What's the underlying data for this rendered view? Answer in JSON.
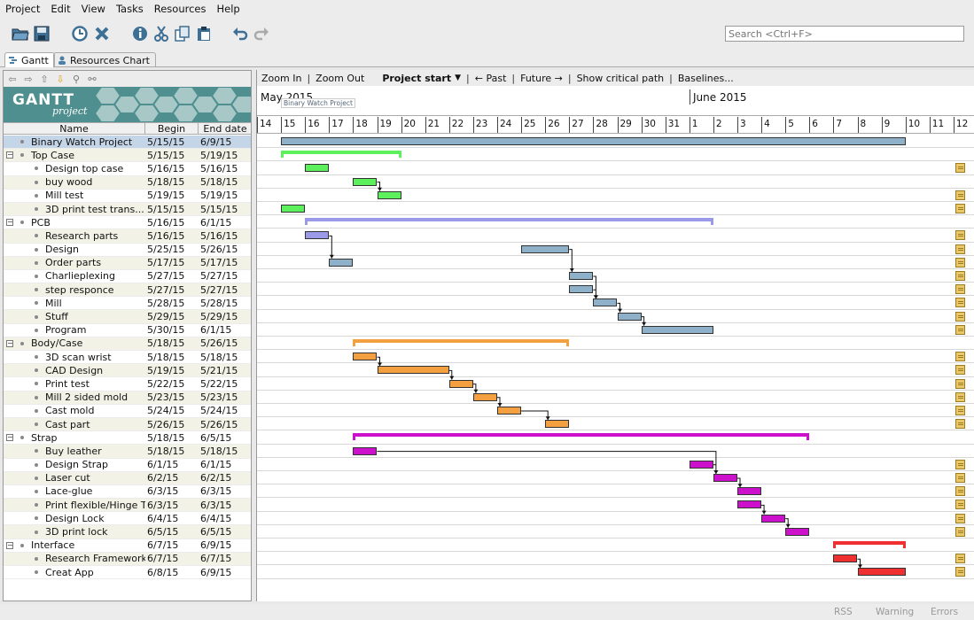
{
  "menu": [
    "Project",
    "Edit",
    "View",
    "Tasks",
    "Resources",
    "Help"
  ],
  "search_placeholder": "Search <Ctrl+F>",
  "tabs": [
    "Gantt",
    "Resources Chart"
  ],
  "logo": {
    "title": "GANTT",
    "subtitle": "project"
  },
  "table_headers": {
    "name": "Name",
    "begin": "Begin date",
    "end": "End date"
  },
  "gantt_toolbar": {
    "zoom_in": "Zoom In",
    "zoom_out": "Zoom Out",
    "project_start": "Project start",
    "past": "← Past",
    "future": "Future →",
    "critical": "Show critical path",
    "baselines": "Baselines..."
  },
  "timeline": {
    "month1": "May 2015",
    "month2": "June 2015",
    "tooltip": "Binary Watch Project",
    "days": [
      "14",
      "15",
      "16",
      "17",
      "18",
      "19",
      "20",
      "21",
      "22",
      "23",
      "24",
      "25",
      "26",
      "27",
      "28",
      "29",
      "30",
      "31",
      "1",
      "2",
      "3",
      "4",
      "5",
      "6",
      "7",
      "8",
      "9",
      "10",
      "11",
      "12"
    ]
  },
  "tasks": [
    {
      "name": "Binary Watch Project",
      "begin": "5/15/15",
      "end": "6/9/15",
      "level": 0,
      "group": false,
      "start": 15,
      "dur": 26,
      "color": "#8eb0c8",
      "note": false
    },
    {
      "name": "Top Case",
      "begin": "5/15/15",
      "end": "5/19/15",
      "level": 0,
      "group": true,
      "start": 15,
      "dur": 5,
      "color": "#5cf05c",
      "note": false
    },
    {
      "name": "Design top case",
      "begin": "5/16/15",
      "end": "5/16/15",
      "level": 1,
      "group": false,
      "start": 16,
      "dur": 1,
      "color": "#5cf05c",
      "note": true
    },
    {
      "name": "buy wood",
      "begin": "5/18/15",
      "end": "5/18/15",
      "level": 1,
      "group": false,
      "start": 18,
      "dur": 1,
      "color": "#5cf05c",
      "note": false
    },
    {
      "name": "Mill test",
      "begin": "5/19/15",
      "end": "5/19/15",
      "level": 1,
      "group": false,
      "start": 19,
      "dur": 1,
      "color": "#5cf05c",
      "note": true
    },
    {
      "name": "3D print test  trans...",
      "begin": "5/15/15",
      "end": "5/15/15",
      "level": 1,
      "group": false,
      "start": 15,
      "dur": 1,
      "color": "#5cf05c",
      "note": true
    },
    {
      "name": "PCB",
      "begin": "5/16/15",
      "end": "6/1/15",
      "level": 0,
      "group": true,
      "start": 16,
      "dur": 17,
      "color": "#9a9ae8",
      "note": false
    },
    {
      "name": "Research parts",
      "begin": "5/16/15",
      "end": "5/16/15",
      "level": 1,
      "group": false,
      "start": 16,
      "dur": 1,
      "color": "#9a9ae8",
      "note": true
    },
    {
      "name": "Design",
      "begin": "5/25/15",
      "end": "5/26/15",
      "level": 1,
      "group": false,
      "start": 25,
      "dur": 2,
      "color": "#8eb0c8",
      "note": true
    },
    {
      "name": "Order parts",
      "begin": "5/17/15",
      "end": "5/17/15",
      "level": 1,
      "group": false,
      "start": 17,
      "dur": 1,
      "color": "#8eb0c8",
      "note": true
    },
    {
      "name": "Charlieplexing",
      "begin": "5/27/15",
      "end": "5/27/15",
      "level": 1,
      "group": false,
      "start": 27,
      "dur": 1,
      "color": "#8eb0c8",
      "note": true
    },
    {
      "name": "step responce",
      "begin": "5/27/15",
      "end": "5/27/15",
      "level": 1,
      "group": false,
      "start": 27,
      "dur": 1,
      "color": "#8eb0c8",
      "note": true
    },
    {
      "name": "Mill",
      "begin": "5/28/15",
      "end": "5/28/15",
      "level": 1,
      "group": false,
      "start": 28,
      "dur": 1,
      "color": "#8eb0c8",
      "note": true
    },
    {
      "name": "Stuff",
      "begin": "5/29/15",
      "end": "5/29/15",
      "level": 1,
      "group": false,
      "start": 29,
      "dur": 1,
      "color": "#8eb0c8",
      "note": true
    },
    {
      "name": "Program",
      "begin": "5/30/15",
      "end": "6/1/15",
      "level": 1,
      "group": false,
      "start": 30,
      "dur": 3,
      "color": "#8eb0c8",
      "note": true
    },
    {
      "name": "Body/Case",
      "begin": "5/18/15",
      "end": "5/26/15",
      "level": 0,
      "group": true,
      "start": 18,
      "dur": 9,
      "color": "#f5a040",
      "note": false
    },
    {
      "name": "3D scan wrist",
      "begin": "5/18/15",
      "end": "5/18/15",
      "level": 1,
      "group": false,
      "start": 18,
      "dur": 1,
      "color": "#f5a040",
      "note": true
    },
    {
      "name": "CAD Design",
      "begin": "5/19/15",
      "end": "5/21/15",
      "level": 1,
      "group": false,
      "start": 19,
      "dur": 3,
      "color": "#f5a040",
      "note": true
    },
    {
      "name": "Print test",
      "begin": "5/22/15",
      "end": "5/22/15",
      "level": 1,
      "group": false,
      "start": 22,
      "dur": 1,
      "color": "#f5a040",
      "note": true
    },
    {
      "name": "Mill 2 sided mold",
      "begin": "5/23/15",
      "end": "5/23/15",
      "level": 1,
      "group": false,
      "start": 23,
      "dur": 1,
      "color": "#f5a040",
      "note": true
    },
    {
      "name": "Cast mold",
      "begin": "5/24/15",
      "end": "5/24/15",
      "level": 1,
      "group": false,
      "start": 24,
      "dur": 1,
      "color": "#f5a040",
      "note": true
    },
    {
      "name": "Cast part",
      "begin": "5/26/15",
      "end": "5/26/15",
      "level": 1,
      "group": false,
      "start": 26,
      "dur": 1,
      "color": "#f5a040",
      "note": true
    },
    {
      "name": "Strap",
      "begin": "5/18/15",
      "end": "6/5/15",
      "level": 0,
      "group": true,
      "start": 18,
      "dur": 19,
      "color": "#cc10cc",
      "note": false
    },
    {
      "name": "Buy leather",
      "begin": "5/18/15",
      "end": "5/18/15",
      "level": 1,
      "group": false,
      "start": 18,
      "dur": 1,
      "color": "#cc10cc",
      "note": false
    },
    {
      "name": "Design Strap",
      "begin": "6/1/15",
      "end": "6/1/15",
      "level": 1,
      "group": false,
      "start": 32,
      "dur": 1,
      "color": "#cc10cc",
      "note": true
    },
    {
      "name": "Laser cut",
      "begin": "6/2/15",
      "end": "6/2/15",
      "level": 1,
      "group": false,
      "start": 33,
      "dur": 1,
      "color": "#cc10cc",
      "note": true
    },
    {
      "name": "Lace-glue",
      "begin": "6/3/15",
      "end": "6/3/15",
      "level": 1,
      "group": false,
      "start": 34,
      "dur": 1,
      "color": "#cc10cc",
      "note": true
    },
    {
      "name": "Print flexible/Hinge T...",
      "begin": "6/3/15",
      "end": "6/3/15",
      "level": 1,
      "group": false,
      "start": 34,
      "dur": 1,
      "color": "#cc10cc",
      "note": true
    },
    {
      "name": "Design Lock",
      "begin": "6/4/15",
      "end": "6/4/15",
      "level": 1,
      "group": false,
      "start": 35,
      "dur": 1,
      "color": "#cc10cc",
      "note": true
    },
    {
      "name": "3D print lock",
      "begin": "6/5/15",
      "end": "6/5/15",
      "level": 1,
      "group": false,
      "start": 36,
      "dur": 1,
      "color": "#cc10cc",
      "note": true
    },
    {
      "name": "Interface",
      "begin": "6/7/15",
      "end": "6/9/15",
      "level": 0,
      "group": true,
      "start": 38,
      "dur": 3,
      "color": "#f03030",
      "note": false
    },
    {
      "name": "Research Framework",
      "begin": "6/7/15",
      "end": "6/7/15",
      "level": 1,
      "group": false,
      "start": 38,
      "dur": 1,
      "color": "#f03030",
      "note": true
    },
    {
      "name": "Creat App",
      "begin": "6/8/15",
      "end": "6/9/15",
      "level": 1,
      "group": false,
      "start": 39,
      "dur": 2,
      "color": "#f03030",
      "note": true
    }
  ],
  "status": {
    "rss": "RSS",
    "warning": "Warning",
    "errors": "Errors"
  }
}
